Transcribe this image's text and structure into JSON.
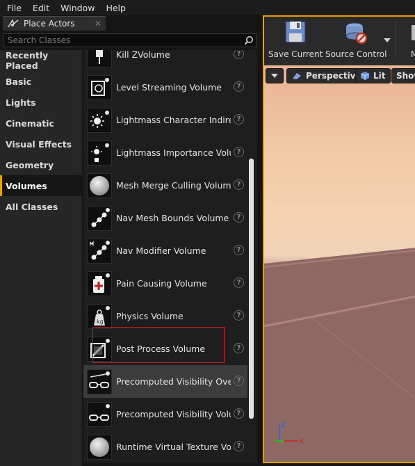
{
  "menu": [
    "File",
    "Edit",
    "Window",
    "Help"
  ],
  "tab": {
    "label": "Place Actors",
    "close": "✕"
  },
  "search": {
    "placeholder": "Search Classes"
  },
  "categories": [
    "Recently Placed",
    "Basic",
    "Lights",
    "Cinematic",
    "Visual Effects",
    "Geometry",
    "Volumes",
    "All Classes"
  ],
  "active_category": "Volumes",
  "items": [
    {
      "label": "Kill ZVolume",
      "icon": "kill-z-volume-icon"
    },
    {
      "label": "Level Streaming Volume",
      "icon": "level-streaming-volume-icon"
    },
    {
      "label": "Lightmass Character Indirec",
      "icon": "lightmass-character-icon"
    },
    {
      "label": "Lightmass Importance Volum",
      "icon": "lightmass-importance-icon"
    },
    {
      "label": "Mesh Merge Culling Volume",
      "icon": "sphere-icon"
    },
    {
      "label": "Nav Mesh Bounds Volume",
      "icon": "nav-mesh-icon"
    },
    {
      "label": "Nav Modifier Volume",
      "icon": "nav-modifier-icon"
    },
    {
      "label": "Pain Causing Volume",
      "icon": "pain-causing-icon"
    },
    {
      "label": "Physics Volume",
      "icon": "physics-volume-icon"
    },
    {
      "label": "Post Process Volume",
      "icon": "post-process-icon"
    },
    {
      "label": "Precomputed Visibility Overr",
      "icon": "glasses-icon"
    },
    {
      "label": "Precomputed Visibility Volun",
      "icon": "glasses-icon"
    },
    {
      "label": "Runtime Virtual Texture Volume",
      "icon": "sphere-icon"
    }
  ],
  "help_glyph": "?",
  "toolbar": {
    "save_label": "Save Current",
    "source_label": "Source Control",
    "more_label": "M"
  },
  "viewport": {
    "perspective": "Perspective",
    "lit": "Lit",
    "show": "Show"
  },
  "colors": {
    "accent": "#e8a200",
    "highlight_box": "#d42020"
  }
}
